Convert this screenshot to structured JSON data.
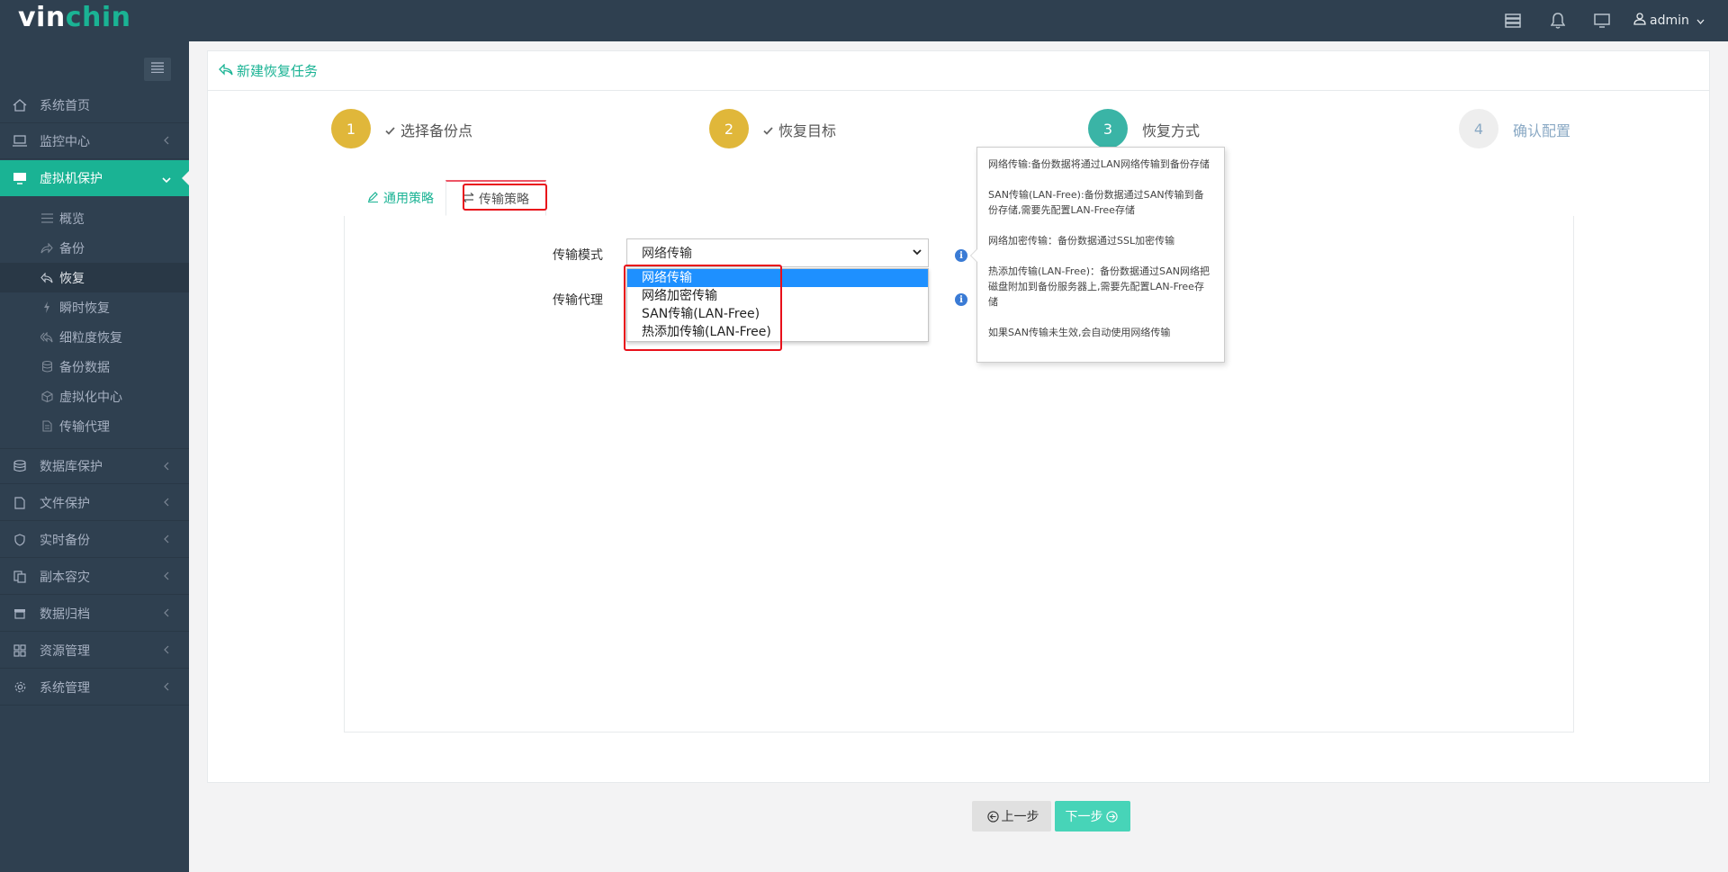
{
  "brand": {
    "logo_part1": "vin",
    "logo_part2": "chin",
    "accent_color": "#1ab394",
    "sidebar_color": "#2f4050"
  },
  "topbar": {
    "user_name": "admin",
    "icons": [
      "server-icon",
      "bell-icon",
      "monitor-icon",
      "user-icon"
    ]
  },
  "sidebar": {
    "items": [
      {
        "label": "系统首页",
        "icon": "home-icon"
      },
      {
        "label": "监控中心",
        "icon": "laptop-icon"
      },
      {
        "label": "虚拟机保护",
        "icon": "desktop-icon"
      },
      {
        "label": "数据库保护",
        "icon": "database-icon"
      },
      {
        "label": "文件保护",
        "icon": "file-icon"
      },
      {
        "label": "实时备份",
        "icon": "shield-icon"
      },
      {
        "label": "副本容灾",
        "icon": "copy-icon"
      },
      {
        "label": "数据归档",
        "icon": "archive-icon"
      },
      {
        "label": "资源管理",
        "icon": "grid-icon"
      },
      {
        "label": "系统管理",
        "icon": "gear-icon"
      }
    ],
    "sub_items": [
      {
        "label": "概览",
        "icon": "list-icon"
      },
      {
        "label": "备份",
        "icon": "share-icon"
      },
      {
        "label": "恢复",
        "icon": "reply-icon"
      },
      {
        "label": "瞬时恢复",
        "icon": "bolt-icon"
      },
      {
        "label": "细粒度恢复",
        "icon": "reply-all-icon"
      },
      {
        "label": "备份数据",
        "icon": "database-icon"
      },
      {
        "label": "虚拟化中心",
        "icon": "cube-icon"
      },
      {
        "label": "传输代理",
        "icon": "file-icon"
      }
    ]
  },
  "page": {
    "title": "新建恢复任务"
  },
  "steps": [
    {
      "number": "1",
      "label": "选择备份点",
      "state": "done",
      "color": "#e0b73a"
    },
    {
      "number": "2",
      "label": "恢复目标",
      "state": "done",
      "color": "#e0b73a"
    },
    {
      "number": "3",
      "label": "恢复方式",
      "state": "current",
      "color": "#3ab4a6"
    },
    {
      "number": "4",
      "label": "确认配置",
      "state": "pending",
      "color": "#eeeeee"
    }
  ],
  "tabs": [
    {
      "label": "通用策略",
      "icon": "edit-icon"
    },
    {
      "label": "传输策略",
      "icon": "exchange-icon"
    }
  ],
  "form": {
    "mode_label": "传输模式",
    "proxy_label": "传输代理",
    "mode_value": "网络传输",
    "mode_options": [
      "网络传输",
      "网络加密传输",
      "SAN传输(LAN-Free)",
      "热添加传输(LAN-Free)"
    ]
  },
  "tooltip": {
    "lines": [
      "网络传输:备份数据将通过LAN网络传输到备份存储",
      "SAN传输(LAN-Free):备份数据通过SAN传输到备份存储,需要先配置LAN-Free存储",
      "网络加密传输：备份数据通过SSL加密传输",
      "热添加传输(LAN-Free)：备份数据通过SAN网络把磁盘附加到备份服务器上,需要先配置LAN-Free存储",
      "如果SAN传输未生效,会自动使用网络传输"
    ]
  },
  "footer": {
    "prev_label": "上一步",
    "next_label": "下一步"
  }
}
